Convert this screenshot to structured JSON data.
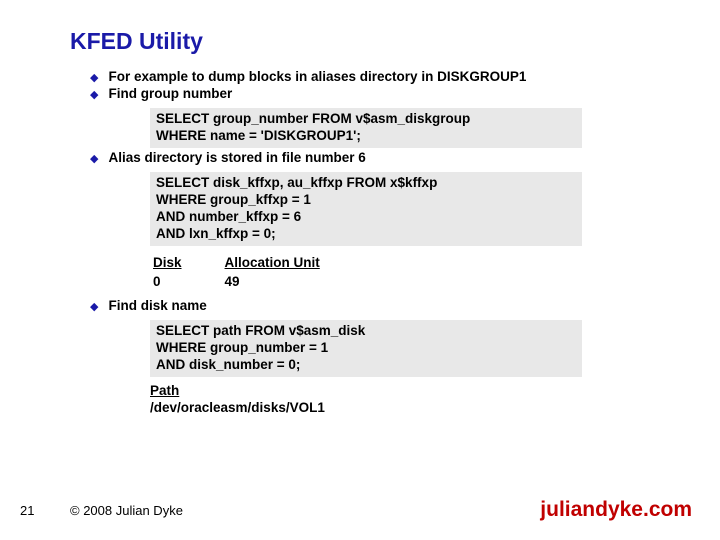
{
  "title": "KFED Utility",
  "bullets": {
    "b1": "For example to dump blocks in aliases directory in DISKGROUP1",
    "b2": "Find group number",
    "b3": "Alias directory is stored in file number 6",
    "b4": "Find disk name"
  },
  "code": {
    "c1": "SELECT group_number FROM v$asm_diskgroup\nWHERE name = 'DISKGROUP1';",
    "c2": "SELECT disk_kffxp, au_kffxp FROM x$kffxp\nWHERE group_kffxp = 1\nAND number_kffxp = 6\nAND lxn_kffxp = 0;",
    "c3": "SELECT path FROM v$asm_disk\nWHERE group_number = 1\nAND disk_number = 0;"
  },
  "table1": {
    "h1": "Disk",
    "h2": "Allocation Unit",
    "r1c1": "0",
    "r1c2": "49"
  },
  "path": {
    "label": "Path",
    "value": "/dev/oracleasm/disks/VOL1"
  },
  "footer": {
    "page": "21",
    "copyright": "© 2008 Julian Dyke",
    "site": "juliandyke.com"
  }
}
